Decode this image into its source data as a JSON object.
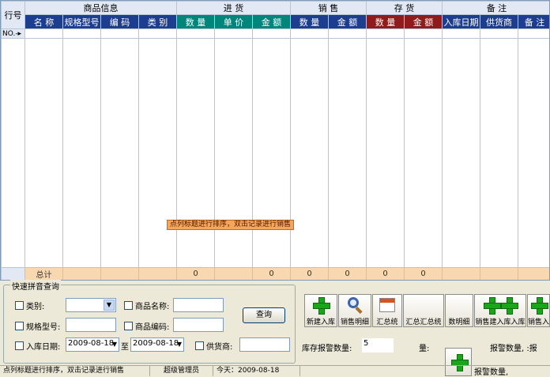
{
  "grid": {
    "row_header": "行号",
    "groups": [
      {
        "label": "商品信息"
      },
      {
        "label": "进 货"
      },
      {
        "label": "销 售"
      },
      {
        "label": "存 货"
      },
      {
        "label": "备 注"
      }
    ],
    "columns": [
      "名 称",
      "规格型号",
      "编 码",
      "类 别",
      "数 量",
      "单 价",
      "金 额",
      "数 量",
      "金 额",
      "数 量",
      "金 额",
      "入库日期",
      "供货商",
      "备 注"
    ],
    "new_row_marker": "NO.-▸",
    "total_label": "总计",
    "totals": [
      "",
      "",
      "",
      "",
      "0",
      "",
      "0",
      "0",
      "0",
      "0",
      "0",
      "",
      "",
      ""
    ],
    "hint": "点列标题进行排序，双击记录进行销售"
  },
  "query": {
    "title": "快速拼音查询",
    "category_label": "类别:",
    "category_value": "",
    "product_name_label": "商品名称:",
    "product_name_value": "",
    "spec_label": "规格型号:",
    "spec_value": "",
    "code_label": "商品编码:",
    "code_value": "",
    "date_label": "入库日期:",
    "date_from": "2009-08-18",
    "date_to_label": "至",
    "date_to": "2009-08-18",
    "supplier_label": "供货商:",
    "supplier_value": "",
    "search_button": "查询"
  },
  "toolbar": {
    "new_stock": "新建入库",
    "sales_detail": "销售明细",
    "summary": "汇总统",
    "summary2": "汇总汇总统",
    "detail": "数明细",
    "sales_stock": "销售建入库入库",
    "sales_in": "销售入"
  },
  "alerts": {
    "stock_alert_label": "库存报警数量:",
    "stock_alert_value": "5",
    "qty_label": "量:",
    "alert_label2": "报警数量, :报",
    "alert_label3": "报警数量,"
  },
  "status": {
    "hint": "点列标题进行排序，双击记录进行销售",
    "user": "超级管理员",
    "today": "今天：2009-08-18"
  }
}
